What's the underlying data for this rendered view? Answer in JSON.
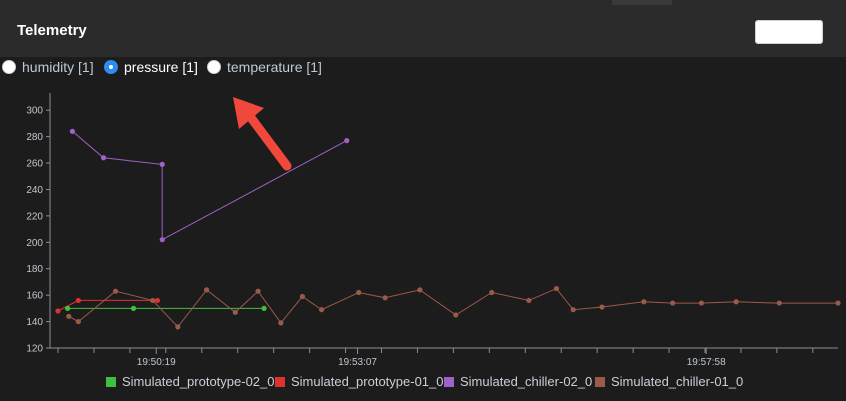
{
  "header": {
    "title": "Telemetry",
    "button_label": ""
  },
  "tabs": [
    {
      "label": "humidity [1]",
      "selected": false
    },
    {
      "label": "pressure [1]",
      "selected": true
    },
    {
      "label": "temperature [1]",
      "selected": false
    }
  ],
  "colors": {
    "Simulated_prototype-02_0": "#3fbf3f",
    "Simulated_prototype-01_0": "#e03030",
    "Simulated_chiller-02_0": "#a062c8",
    "Simulated_chiller-01_0": "#9a5a4a",
    "arrow": "#f0483a"
  },
  "chart_data": {
    "type": "line",
    "title": "",
    "xlabel": "",
    "ylabel": "",
    "ylim": [
      120,
      310
    ],
    "yticks": [
      120,
      140,
      160,
      180,
      200,
      220,
      240,
      260,
      280,
      300
    ],
    "xlim": [
      "19:48:57",
      "19:59:48"
    ],
    "xticks": [
      "19:50:19",
      "19:53:07",
      "19:57:58"
    ],
    "grid": false,
    "legend": "bottom",
    "series": [
      {
        "name": "Simulated_prototype-02_0",
        "x": [
          "19:49:05",
          "19:50:00",
          "19:51:49"
        ],
        "y": [
          150,
          150,
          150
        ]
      },
      {
        "name": "Simulated_prototype-01_0",
        "x": [
          "19:48:57",
          "19:49:14",
          "19:50:20"
        ],
        "y": [
          148,
          156,
          156
        ]
      },
      {
        "name": "Simulated_chiller-02_0",
        "x": [
          "19:49:09",
          "19:49:35",
          "19:50:24",
          "19:50:24",
          "19:52:58"
        ],
        "y": [
          284,
          264,
          259,
          202,
          277
        ]
      },
      {
        "name": "Simulated_chiller-01_0",
        "x": [
          "19:49:06",
          "19:49:14",
          "19:49:45",
          "19:50:16",
          "19:50:37",
          "19:51:01",
          "19:51:25",
          "19:51:44",
          "19:52:03",
          "19:52:21",
          "19:52:37",
          "19:53:08",
          "19:53:30",
          "19:53:59",
          "19:54:29",
          "19:54:59",
          "19:55:30",
          "19:55:53",
          "19:56:07",
          "19:56:31",
          "19:57:06",
          "19:57:30",
          "19:57:54",
          "19:58:23",
          "19:58:59",
          "19:59:48"
        ],
        "y": [
          144,
          140,
          163,
          156,
          136,
          164,
          147,
          163,
          139,
          159,
          149,
          162,
          158,
          164,
          145,
          162,
          156,
          165,
          149,
          151,
          155,
          154,
          154,
          155,
          154,
          154
        ]
      }
    ]
  }
}
